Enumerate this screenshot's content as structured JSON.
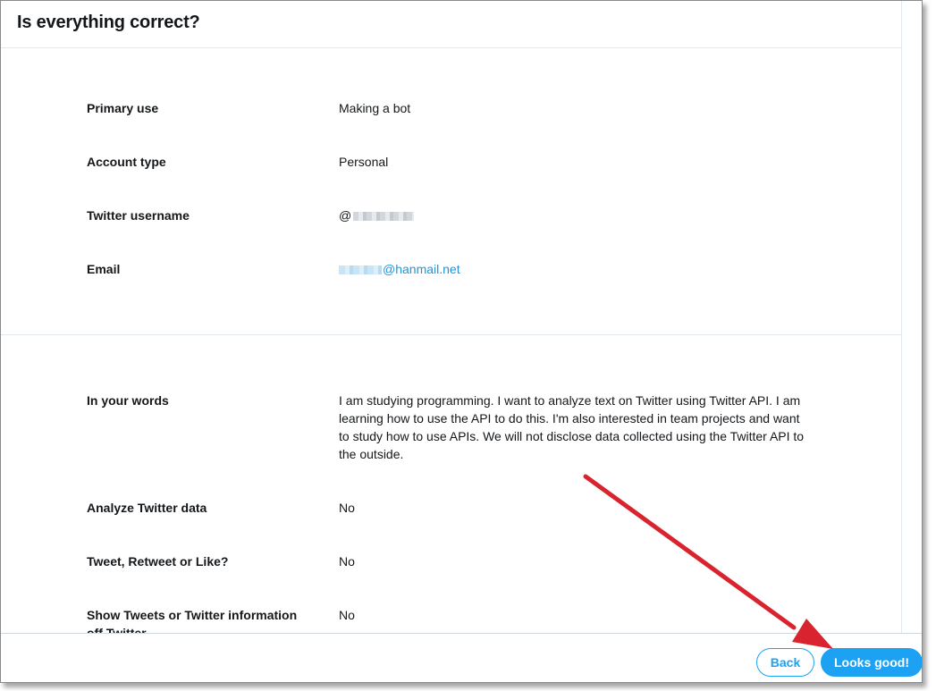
{
  "dialog": {
    "title": "Is everything correct?"
  },
  "account_section": {
    "rows": [
      {
        "label": "Primary use",
        "value": "Making a bot"
      },
      {
        "label": "Account type",
        "value": "Personal"
      },
      {
        "label": "Twitter username",
        "value_prefix": "@"
      },
      {
        "label": "Email",
        "value_suffix": "@hanmail.net"
      }
    ]
  },
  "details_section": {
    "rows": [
      {
        "label": "In your words",
        "value": "I am studying programming. I want to analyze text on Twitter using Twitter API. I am learning how to use the API to do this. I'm also interested in team projects and want to study how to use APIs. We will not disclose data collected using the Twitter API to the outside."
      },
      {
        "label": "Analyze Twitter data",
        "value": "No"
      },
      {
        "label": "Tweet, Retweet or Like?",
        "value": "No"
      },
      {
        "label": "Show Tweets or Twitter information off Twitter",
        "value": "No"
      }
    ]
  },
  "footer": {
    "back_label": "Back",
    "confirm_label": "Looks good!"
  },
  "colors": {
    "accent": "#1da1f2",
    "link": "#1b95e0",
    "annotation_arrow": "#d9232e"
  },
  "icons": {
    "annotation": "red-arrow-icon"
  }
}
